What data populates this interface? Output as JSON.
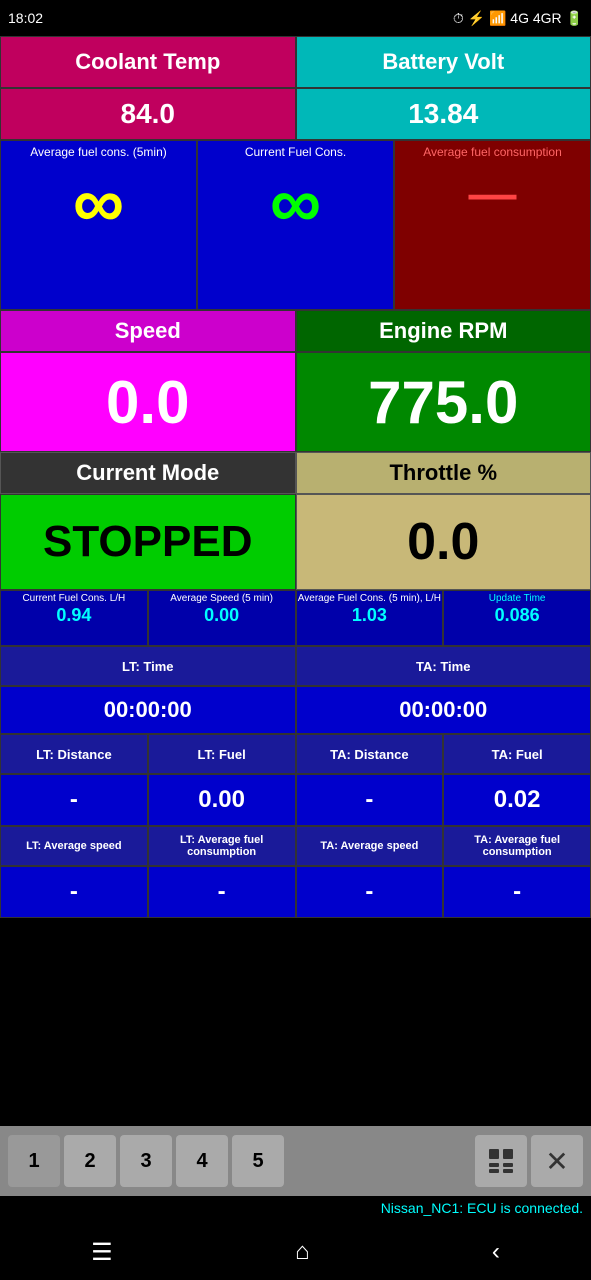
{
  "statusBar": {
    "time": "18:02",
    "icons": "status icons"
  },
  "coolantTemp": {
    "label": "Coolant Temp",
    "value": "84.0"
  },
  "batteryVolt": {
    "label": "Battery Volt",
    "value": "13.84"
  },
  "avgFuelCons": {
    "label": "Average fuel cons. (5min)",
    "symbol": "∞",
    "color": "yellow"
  },
  "currentFuelCons": {
    "label": "Current Fuel Cons.",
    "symbol": "∞",
    "color": "green"
  },
  "avgFuelRight": {
    "label": "Average fuel consumption",
    "symbol": "–"
  },
  "speed": {
    "label": "Speed",
    "value": "0.0"
  },
  "engineRPM": {
    "label": "Engine RPM",
    "value": "775.0"
  },
  "currentMode": {
    "label": "Current Mode",
    "value": "STOPPED"
  },
  "throttle": {
    "label": "Throttle %",
    "value": "0.0"
  },
  "fuelStats": {
    "currentFuelConsLH": {
      "label": "Current Fuel Cons. L/H",
      "value": "0.94"
    },
    "avgSpeed5min": {
      "label": "Average Speed (5 min)",
      "value": "0.00"
    },
    "avgFuelCons5min": {
      "label": "Average Fuel Cons. (5 min), L/H",
      "value": "1.03"
    },
    "updateTime": {
      "label": "Update Time",
      "value": "0.086"
    }
  },
  "ltTime": {
    "label": "LT: Time",
    "value": "00:00:00"
  },
  "taTime": {
    "label": "TA: Time",
    "value": "00:00:00"
  },
  "ltDistance": {
    "label": "LT: Distance",
    "value": "-"
  },
  "ltFuel": {
    "label": "LT: Fuel",
    "value": "0.00"
  },
  "taDistance": {
    "label": "TA: Distance",
    "value": "-"
  },
  "taFuel": {
    "label": "TA: Fuel",
    "value": "0.02"
  },
  "ltAvgSpeed": {
    "label": "LT: Average speed",
    "value": "-"
  },
  "ltAvgFuel": {
    "label": "LT: Average fuel consumption",
    "value": "-"
  },
  "taAvgSpeed": {
    "label": "TA: Average speed",
    "value": "-"
  },
  "taAvgFuel": {
    "label": "TA: Average fuel consumption",
    "value": "-"
  },
  "tabs": {
    "t1": "1",
    "t2": "2",
    "t3": "3",
    "t4": "4",
    "t5": "5"
  },
  "statusMessage": "Nissan_NC1: ECU is connected."
}
